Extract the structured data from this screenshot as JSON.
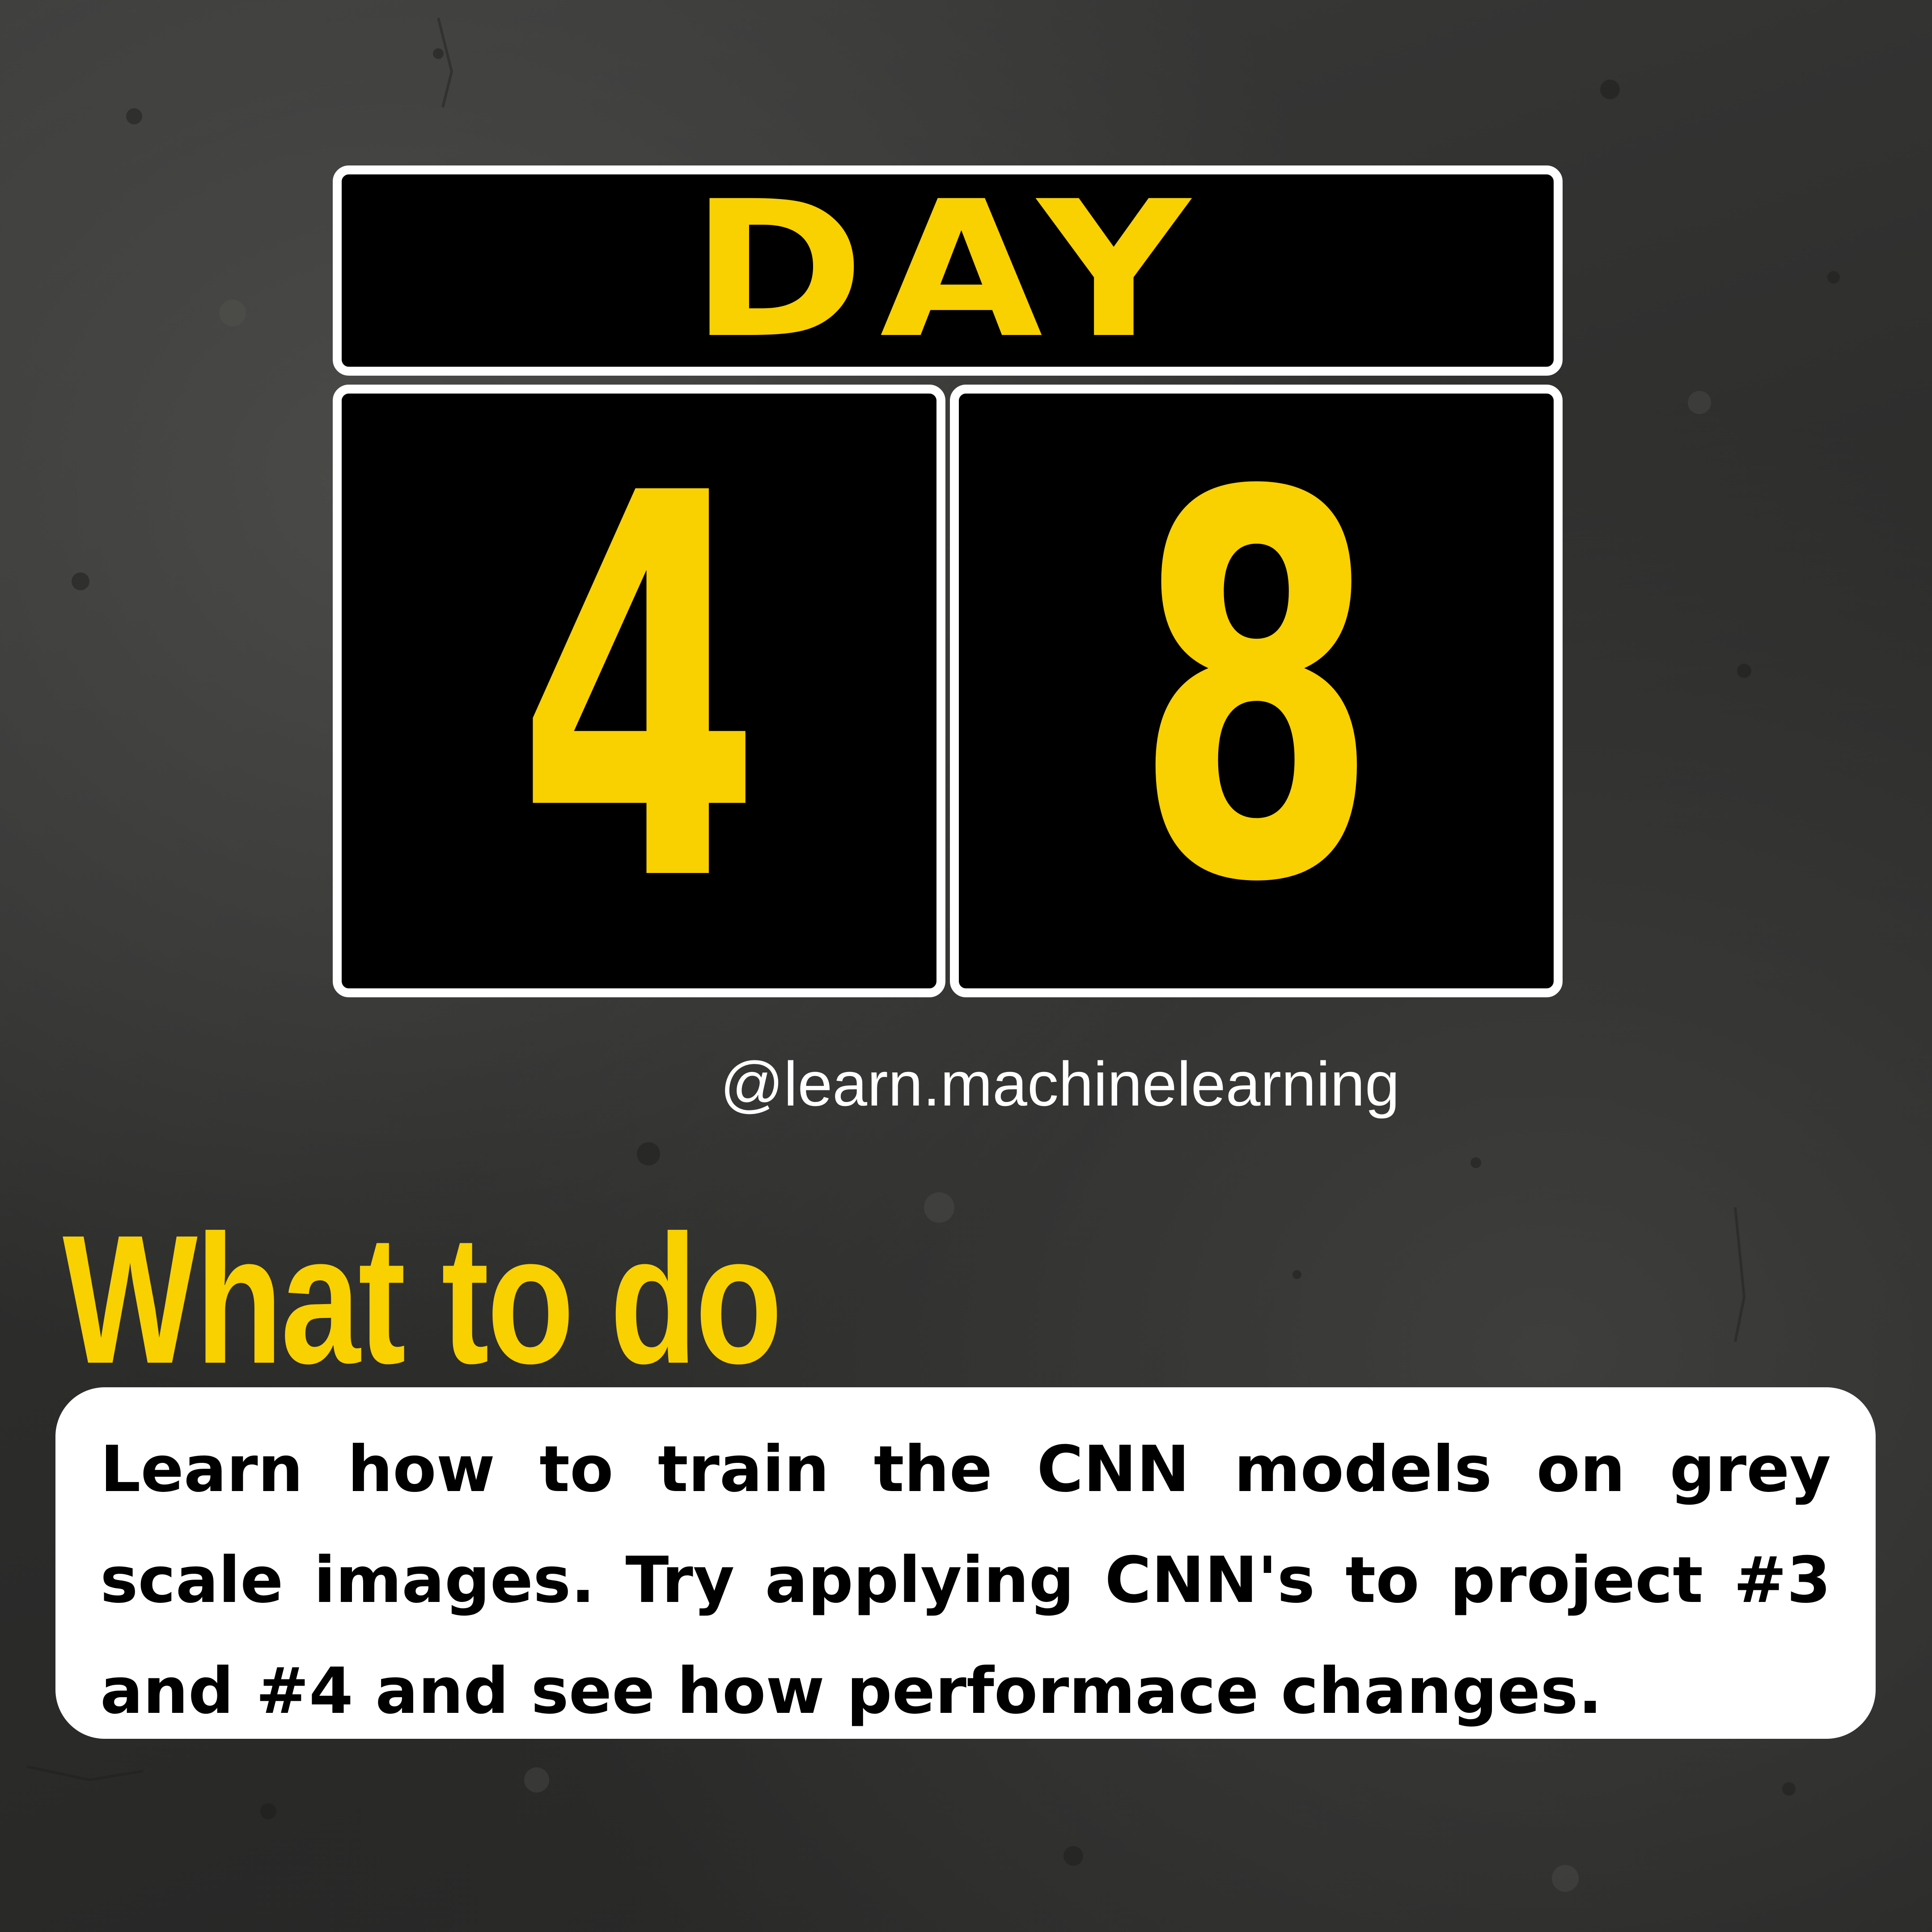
{
  "colors": {
    "accent": "#f9d000",
    "tile_background": "#000000",
    "tile_border": "#ffffff",
    "page_background": "#2f2f2e",
    "card_background": "#ffffff",
    "card_text": "#000000"
  },
  "counter": {
    "label": "DAY",
    "digit_1": "4",
    "digit_2": "8"
  },
  "handle": "@learn.machinelearning",
  "section": {
    "heading": "What to do",
    "body": "Learn how to train the CNN models on grey scale images. Try applying CNN's to project  #3 and #4 and see how performace changes."
  }
}
